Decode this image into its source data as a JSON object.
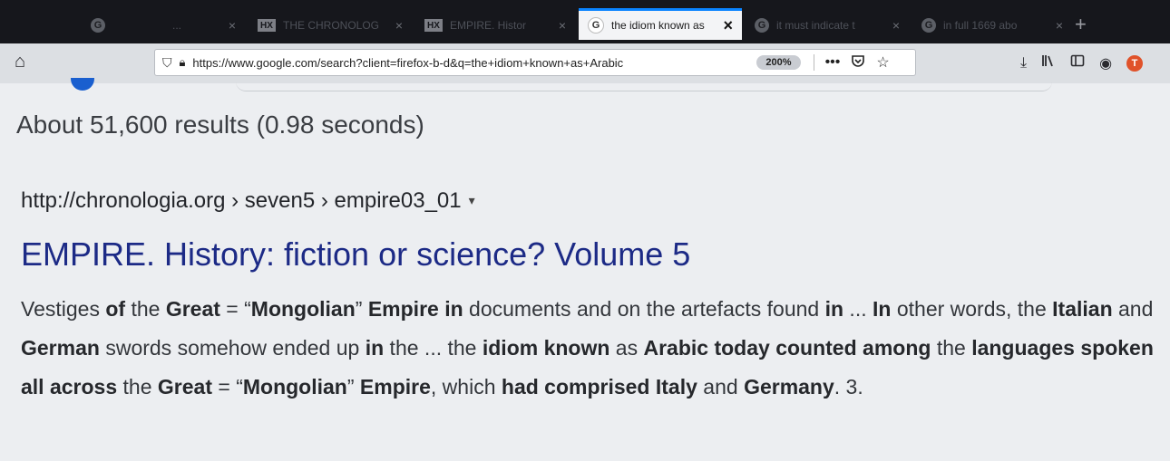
{
  "tabs": [
    {
      "favicon": "G",
      "title": "",
      "close": ""
    },
    {
      "favicon": "",
      "title": "...",
      "close": "×"
    },
    {
      "favicon": "HX",
      "title": "THE CHRONOLOG",
      "close": "×"
    },
    {
      "favicon": "HX",
      "title": "EMPIRE. Histor",
      "close": "×"
    },
    {
      "favicon": "G",
      "title": "the idiom known as",
      "close": "×",
      "active": true
    },
    {
      "favicon": "G",
      "title": "it must indicate t",
      "close": "×"
    },
    {
      "favicon": "G",
      "title": "in full 1669 abo",
      "close": "×"
    }
  ],
  "new_tab": "+",
  "nav": {
    "home_icon": "home-icon",
    "url": "https://www.google.com/search?client=firefox-b-d&q=the+idiom+known+as+Arabic",
    "zoom": "200%",
    "page_actions": "•••"
  },
  "page": {
    "stats": "About 51,600 results (0.98 seconds)",
    "cite": "http://chronologia.org › seven5 › empire03_01",
    "cite_arrow": "▾",
    "title": "EMPIRE. History: fiction or science? Volume 5",
    "snippet": [
      {
        "t": "Vestiges ",
        "b": false
      },
      {
        "t": "of",
        "b": true
      },
      {
        "t": " the ",
        "b": false
      },
      {
        "t": "Great",
        "b": true
      },
      {
        "t": " = “",
        "b": false
      },
      {
        "t": "Mongolian",
        "b": true
      },
      {
        "t": "” ",
        "b": false
      },
      {
        "t": "Empire in",
        "b": true
      },
      {
        "t": " documents and on the artefacts found ",
        "b": false
      },
      {
        "t": "in",
        "b": true
      },
      {
        "t": " ... ",
        "b": false
      },
      {
        "t": "In",
        "b": true
      },
      {
        "t": " other words, the ",
        "b": false
      },
      {
        "t": "Italian",
        "b": true
      },
      {
        "t": " and ",
        "b": false
      },
      {
        "t": "German",
        "b": true
      },
      {
        "t": " swords somehow ended up ",
        "b": false
      },
      {
        "t": "in",
        "b": true
      },
      {
        "t": " the ... the ",
        "b": false
      },
      {
        "t": "idiom known",
        "b": true
      },
      {
        "t": " as ",
        "b": false
      },
      {
        "t": "Arabic today counted among",
        "b": true
      },
      {
        "t": " the ",
        "b": false
      },
      {
        "t": "languages spoken all across",
        "b": true
      },
      {
        "t": " the ",
        "b": false
      },
      {
        "t": "Great",
        "b": true
      },
      {
        "t": " = “",
        "b": false
      },
      {
        "t": "Mongolian",
        "b": true
      },
      {
        "t": "” ",
        "b": false
      },
      {
        "t": "Empire",
        "b": true
      },
      {
        "t": ", which ",
        "b": false
      },
      {
        "t": "had comprised Italy",
        "b": true
      },
      {
        "t": " and ",
        "b": false
      },
      {
        "t": "Germany",
        "b": true
      },
      {
        "t": ". 3.",
        "b": false
      }
    ]
  },
  "colors": {
    "accent": "#0a84ff",
    "result_title": "#1c2a86",
    "google_blue": "#1a5fcf"
  }
}
